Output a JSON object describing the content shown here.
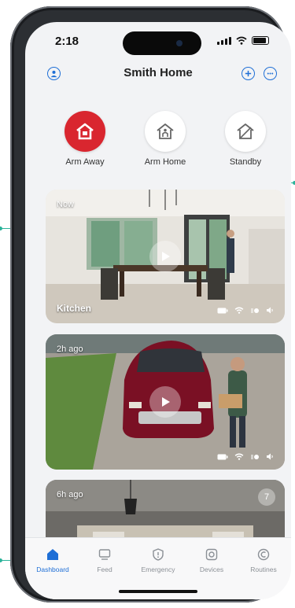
{
  "status": {
    "time": "2:18"
  },
  "header": {
    "title": "Smith Home"
  },
  "modes": [
    {
      "label": "Arm Away",
      "icon": "house-lock-icon",
      "active": true
    },
    {
      "label": "Arm Home",
      "icon": "house-person-icon",
      "active": false
    },
    {
      "label": "Standby",
      "icon": "house-off-icon",
      "active": false
    }
  ],
  "cameras": [
    {
      "timestamp": "Now",
      "name": "Kitchen"
    },
    {
      "timestamp": "2h ago",
      "name": ""
    },
    {
      "timestamp": "6h ago",
      "name": "",
      "badge": "7"
    }
  ],
  "tabs": [
    {
      "label": "Dashboard",
      "icon": "house-icon",
      "active": true
    },
    {
      "label": "Feed",
      "icon": "monitor-icon",
      "active": false
    },
    {
      "label": "Emergency",
      "icon": "shield-alert-icon",
      "active": false
    },
    {
      "label": "Devices",
      "icon": "camera-device-icon",
      "active": false
    },
    {
      "label": "Routines",
      "icon": "routine-icon",
      "active": false
    }
  ],
  "colors": {
    "accent": "#1f6fd6",
    "arm_red": "#d9262f",
    "callout": "#2bb39a"
  }
}
